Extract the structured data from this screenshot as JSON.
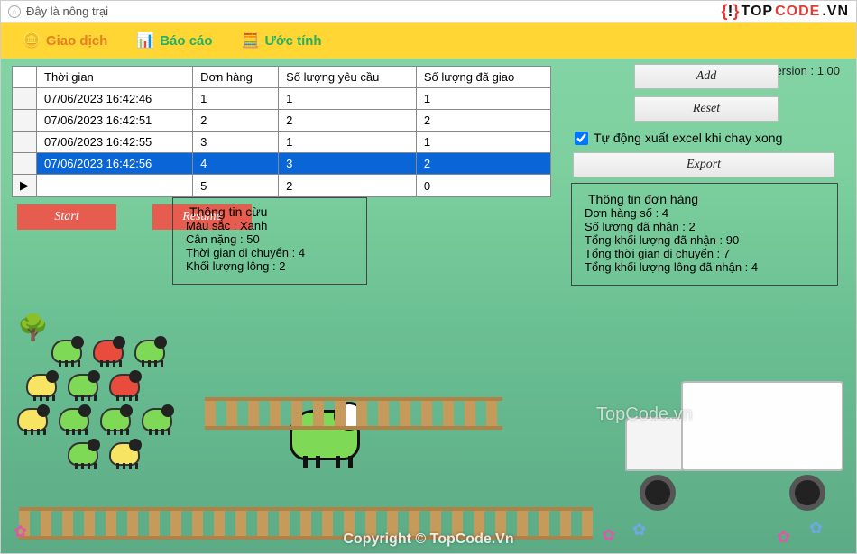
{
  "titlebar": {
    "title": "Đây là nông trại"
  },
  "logo": {
    "top": "TOP",
    "code": "CODE",
    "vn": ".VN"
  },
  "tabs": {
    "giao_dich": "Giao dịch",
    "bao_cao": "Báo cáo",
    "uoc_tinh": "Ước tính"
  },
  "version_label": "Version : 1.00",
  "table": {
    "headers": {
      "time": "Thời gian",
      "order": "Đơn hàng",
      "qty_req": "Số lượng yêu cầu",
      "qty_done": "Số lượng đã giao"
    },
    "rows": [
      {
        "time": "07/06/2023 16:42:46",
        "order": "1",
        "req": "1",
        "done": "1",
        "selected": false
      },
      {
        "time": "07/06/2023 16:42:51",
        "order": "2",
        "req": "2",
        "done": "2",
        "selected": false
      },
      {
        "time": "07/06/2023 16:42:55",
        "order": "3",
        "req": "1",
        "done": "1",
        "selected": false
      },
      {
        "time": "07/06/2023 16:42:56",
        "order": "4",
        "req": "3",
        "done": "2",
        "selected": true
      },
      {
        "time": "",
        "order": "5",
        "req": "2",
        "done": "0",
        "selected": false,
        "current": true
      }
    ]
  },
  "buttons": {
    "add": "Add",
    "reset": "Reset",
    "export": "Export",
    "start": "Start",
    "resume": "Resume"
  },
  "checkbox": {
    "label": "Tự động xuất excel khi chạy xong",
    "checked": true
  },
  "order_info": {
    "title": "Thông tin đơn hàng",
    "l1": "Đơn hàng số : 4",
    "l2": "Số lượng đã nhận : 2",
    "l3": "Tổng khối lượng đã nhận : 90",
    "l4": "Tổng thời gian di chuyển : 7",
    "l5": "Tổng khối lượng lông đã nhận : 4"
  },
  "sheep_info": {
    "title": "Thông tin cừu",
    "l1": "Màu sắc : Xanh",
    "l2": "Cân nặng : 50",
    "l3": "Thời gian di chuyển : 4",
    "l4": "Khối lượng lông : 2"
  },
  "watermark": {
    "center": "TopCode.vn",
    "bottom": "Copyright © TopCode.Vn"
  }
}
